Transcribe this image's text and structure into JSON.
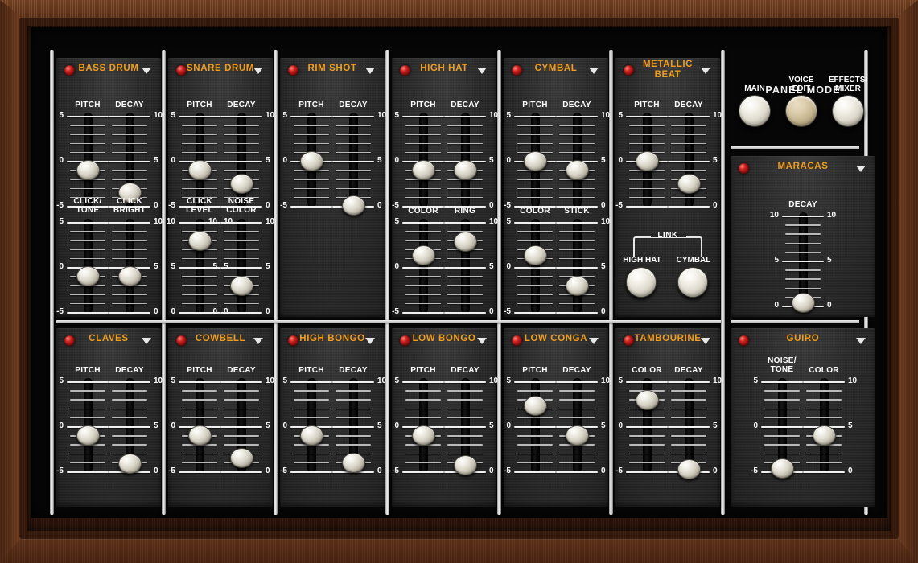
{
  "panel": {
    "title": "VOICE EDIT",
    "panel_mode_title": "PANEL MODE",
    "accent_color": "#f29d1e",
    "led_color": "#d02020"
  },
  "panel_mode": {
    "buttons": [
      {
        "label": "MAIN",
        "active": false
      },
      {
        "label": "VOICE\nEDIT",
        "label_line1": "VOICE",
        "label_line2": "EDIT",
        "active": true
      },
      {
        "label": "EFFECTS/\nMIXER",
        "label_line1": "EFFECTS/",
        "label_line2": "MIXER",
        "active": false
      }
    ]
  },
  "link": {
    "title": "LINK",
    "buttons": [
      {
        "label": "HIGH HAT"
      },
      {
        "label": "CYMBAL"
      }
    ]
  },
  "instruments": [
    {
      "id": "bass-drum",
      "name": "BASS DRUM",
      "col": 0,
      "row": 0,
      "sliders": [
        {
          "label": "PITCH",
          "label2": "",
          "scale": "pitch",
          "value": 0,
          "pct": 0.5
        },
        {
          "label": "DECAY",
          "label2": "",
          "scale": "decay",
          "value": 2,
          "pct": 0.2
        },
        {
          "label": "CLICK/",
          "label2": "TONE",
          "scale": "pitch",
          "value": 0,
          "pct": 0.5
        },
        {
          "label": "CLICK",
          "label2": "BRIGHT",
          "scale": "decay",
          "value": 5,
          "pct": 0.5
        }
      ]
    },
    {
      "id": "snare-drum",
      "name": "SNARE DRUM",
      "col": 1,
      "row": 0,
      "sliders": [
        {
          "label": "PITCH",
          "label2": "",
          "scale": "pitch",
          "value": 0,
          "pct": 0.5
        },
        {
          "label": "DECAY",
          "label2": "",
          "scale": "decay",
          "value": 3,
          "pct": 0.32
        },
        {
          "label": "CLICK",
          "label2": "LEVEL",
          "scale": "zeroten",
          "value": 10,
          "pct": 0.97
        },
        {
          "label": "NOISE",
          "label2": "COLOR",
          "scale": "zeroten",
          "value": 4,
          "pct": 0.37
        }
      ]
    },
    {
      "id": "rim-shot",
      "name": "RIM SHOT",
      "col": 2,
      "row": 0,
      "sliders": [
        {
          "label": "PITCH",
          "label2": "",
          "scale": "pitch",
          "value": 1,
          "pct": 0.62
        },
        {
          "label": "DECAY",
          "label2": "",
          "scale": "decay",
          "value": 0,
          "pct": 0.03
        }
      ]
    },
    {
      "id": "high-hat",
      "name": "HIGH HAT",
      "col": 3,
      "row": 0,
      "sliders": [
        {
          "label": "PITCH",
          "label2": "",
          "scale": "pitch",
          "value": 0,
          "pct": 0.5
        },
        {
          "label": "DECAY",
          "label2": "",
          "scale": "decay",
          "value": 5,
          "pct": 0.5
        },
        {
          "label": "COLOR",
          "label2": "",
          "scale": "pitch",
          "value": 3,
          "pct": 0.78
        },
        {
          "label": "RING",
          "label2": "",
          "scale": "decay",
          "value": 10,
          "pct": 0.96
        }
      ]
    },
    {
      "id": "cymbal",
      "name": "CYMBAL",
      "col": 4,
      "row": 0,
      "sliders": [
        {
          "label": "PITCH",
          "label2": "",
          "scale": "pitch",
          "value": 1,
          "pct": 0.62
        },
        {
          "label": "DECAY",
          "label2": "",
          "scale": "decay",
          "value": 5,
          "pct": 0.5
        },
        {
          "label": "COLOR",
          "label2": "",
          "scale": "pitch",
          "value": 3,
          "pct": 0.78
        },
        {
          "label": "STICK",
          "label2": "",
          "scale": "decay",
          "value": 4,
          "pct": 0.37
        }
      ]
    },
    {
      "id": "metallic-beat",
      "name": "METALLIC BEAT",
      "name_line1": "METALLIC",
      "name_line2": "BEAT",
      "col": 5,
      "row": 0,
      "sliders": [
        {
          "label": "PITCH",
          "label2": "",
          "scale": "pitch",
          "value": 1,
          "pct": 0.62
        },
        {
          "label": "DECAY",
          "label2": "",
          "scale": "decay",
          "value": 3,
          "pct": 0.32
        }
      ]
    },
    {
      "id": "maracas",
      "name": "MARACAS",
      "col": 6,
      "row": 0,
      "sliders": [
        {
          "label": "DECAY",
          "label2": "",
          "scale": "tenzero",
          "value": 0,
          "pct": 0.06
        }
      ]
    },
    {
      "id": "claves",
      "name": "CLAVES",
      "col": 0,
      "row": 1,
      "sliders": [
        {
          "label": "PITCH",
          "label2": "",
          "scale": "pitch",
          "value": 0,
          "pct": 0.5
        },
        {
          "label": "DECAY",
          "label2": "",
          "scale": "decay",
          "value": 1,
          "pct": 0.12
        }
      ]
    },
    {
      "id": "cowbell",
      "name": "COWBELL",
      "col": 1,
      "row": 1,
      "sliders": [
        {
          "label": "PITCH",
          "label2": "",
          "scale": "pitch",
          "value": 0,
          "pct": 0.5
        },
        {
          "label": "DECAY",
          "label2": "",
          "scale": "decay",
          "value": 2,
          "pct": 0.2
        }
      ]
    },
    {
      "id": "high-bongo",
      "name": "HIGH BONGO",
      "col": 2,
      "row": 1,
      "sliders": [
        {
          "label": "PITCH",
          "label2": "",
          "scale": "pitch",
          "value": 0,
          "pct": 0.5
        },
        {
          "label": "DECAY",
          "label2": "",
          "scale": "decay",
          "value": 1,
          "pct": 0.13
        }
      ]
    },
    {
      "id": "low-bongo",
      "name": "LOW BONGO",
      "col": 3,
      "row": 1,
      "sliders": [
        {
          "label": "PITCH",
          "label2": "",
          "scale": "pitch",
          "value": 0,
          "pct": 0.5
        },
        {
          "label": "DECAY",
          "label2": "",
          "scale": "decay",
          "value": 1,
          "pct": 0.1
        }
      ]
    },
    {
      "id": "low-conga",
      "name": "LOW CONGA",
      "col": 4,
      "row": 1,
      "sliders": [
        {
          "label": "PITCH",
          "label2": "",
          "scale": "pitch",
          "value": 4,
          "pct": 0.9
        },
        {
          "label": "DECAY",
          "label2": "",
          "scale": "decay",
          "value": 5,
          "pct": 0.5
        }
      ]
    },
    {
      "id": "tambourine",
      "name": "TAMBOURINE",
      "col": 5,
      "row": 1,
      "sliders": [
        {
          "label": "COLOR",
          "label2": "",
          "scale": "pitch",
          "value": 5,
          "pct": 0.97
        },
        {
          "label": "DECAY",
          "label2": "",
          "scale": "decay",
          "value": 0,
          "pct": 0.05
        }
      ]
    },
    {
      "id": "guiro",
      "name": "GUIRO",
      "col": 6,
      "row": 1,
      "sliders": [
        {
          "label": "NOISE/",
          "label2": "TONE",
          "scale": "pitch",
          "value": -5,
          "pct": 0.06
        },
        {
          "label": "COLOR",
          "label2": "",
          "scale": "decay",
          "value": 5,
          "pct": 0.5
        }
      ]
    }
  ],
  "scales": {
    "pitch": {
      "top": "5",
      "mid": "0",
      "bottom": "-5",
      "side": "left"
    },
    "decay": {
      "top": "10",
      "mid": "5",
      "bottom": "0",
      "side": "right"
    },
    "zeroten": {
      "top": "10",
      "mid": "5",
      "bottom": "0",
      "side": "both"
    },
    "tenzero": {
      "top": "10",
      "mid": "5",
      "bottom": "0",
      "side": "both"
    }
  }
}
